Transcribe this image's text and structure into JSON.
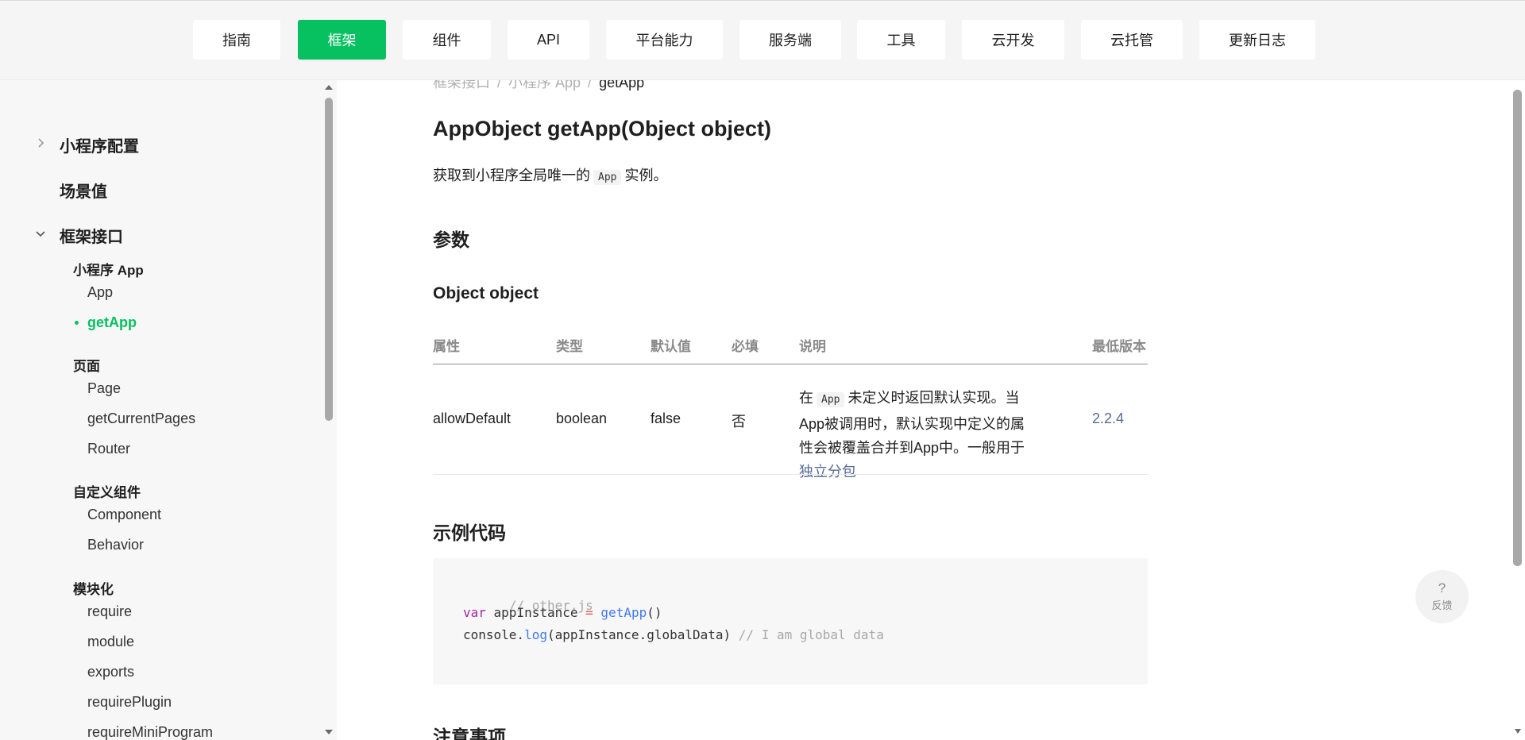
{
  "topnav": {
    "items": [
      {
        "label": "指南"
      },
      {
        "label": "框架",
        "active": true
      },
      {
        "label": "组件"
      },
      {
        "label": "API"
      },
      {
        "label": "平台能力"
      },
      {
        "label": "服务端"
      },
      {
        "label": "工具"
      },
      {
        "label": "云开发"
      },
      {
        "label": "云托管"
      },
      {
        "label": "更新日志"
      }
    ]
  },
  "sidebar": {
    "items": [
      {
        "label": "小程序配置",
        "expanded": false
      },
      {
        "label": "场景值"
      },
      {
        "label": "框架接口",
        "expanded": true
      },
      {
        "label": "小程序 App"
      },
      {
        "label": "App"
      },
      {
        "label": "getApp",
        "active": true
      },
      {
        "label": "页面"
      },
      {
        "label": "Page"
      },
      {
        "label": "getCurrentPages"
      },
      {
        "label": "Router"
      },
      {
        "label": "自定义组件"
      },
      {
        "label": "Component"
      },
      {
        "label": "Behavior"
      },
      {
        "label": "模块化"
      },
      {
        "label": "require"
      },
      {
        "label": "module"
      },
      {
        "label": "exports"
      },
      {
        "label": "requirePlugin"
      },
      {
        "label": "requireMiniProgram"
      }
    ]
  },
  "breadcrumb": {
    "items": [
      "框架接口",
      "小程序 App"
    ],
    "separator": "/",
    "current": "getApp"
  },
  "article": {
    "title": "AppObject getApp(Object object)",
    "desc_before": "获取到小程序全局唯一的",
    "desc_code": "App",
    "desc_after": "实例。",
    "params_heading": "参数",
    "object_heading": "Object object",
    "table": {
      "headers": [
        "属性",
        "类型",
        "默认值",
        "必填",
        "说明",
        "最低版本"
      ],
      "row": {
        "prop": "allowDefault",
        "type": "boolean",
        "default": "false",
        "required": "否",
        "desc_prefix": "在",
        "desc_code": "App",
        "desc_mid": "未定义时返回默认实现。当App被调用时，默认实现中定义的属性会被覆盖合并到App中。一般用于",
        "desc_link": "独立分包",
        "version": "2.2.4"
      }
    },
    "example_heading": "示例代码",
    "code": {
      "line1": "// other.js",
      "line2_kw": "var",
      "line2_name": " appInstance ",
      "line2_op": "=",
      "line2_fn": "getApp",
      "line2_end": "()",
      "line3_obj": "console.",
      "line3_fn": "log",
      "line3_args": "(appInstance.globalData) ",
      "line3_comment": "// I am global data"
    },
    "notes_heading": "注意事项"
  },
  "feedback": {
    "symbol": "?",
    "label": "反馈"
  },
  "colors": {
    "accent": "#07c160",
    "link": "#576b95"
  }
}
